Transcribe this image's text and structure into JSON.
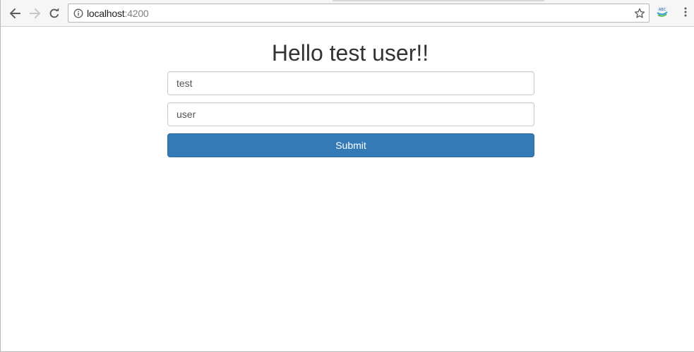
{
  "browser": {
    "url_host": "localhost",
    "url_port": ":4200",
    "icons": {
      "back": "back-arrow-icon",
      "forward": "forward-arrow-icon",
      "reload": "reload-icon",
      "site_info": "info-icon",
      "bookmark": "star-icon",
      "extension": "extension-icon",
      "menu": "kebab-menu-icon"
    }
  },
  "page": {
    "heading": "Hello test user!!",
    "fields": [
      {
        "value": "test"
      },
      {
        "value": "user"
      }
    ],
    "submit_label": "Submit"
  },
  "colors": {
    "primary_button": "#337ab7",
    "heading_text": "#333333",
    "input_border": "#cccccc"
  }
}
